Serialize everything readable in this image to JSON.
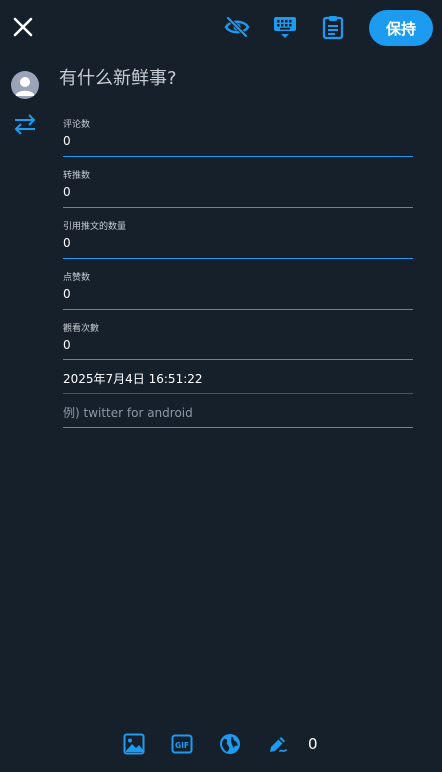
{
  "header": {
    "close_icon": "close-icon",
    "visibility_icon": "eye-off-icon",
    "keyboard_icon": "keyboard-icon",
    "clipboard_icon": "clipboard-icon",
    "save_label": "保持"
  },
  "compose": {
    "placeholder": "有什么新鲜事?"
  },
  "fields": {
    "comments": {
      "label": "评论数",
      "value": "0"
    },
    "retweets": {
      "label": "转推数",
      "value": "0"
    },
    "quotes": {
      "label": "引用推文的数量",
      "value": "0"
    },
    "likes": {
      "label": "点赞数",
      "value": "0"
    },
    "views": {
      "label": "觀看次數",
      "value": "0"
    },
    "datetime": {
      "value": "2025年7月4日 16:51:22"
    },
    "client": {
      "placeholder": "例) twitter for android"
    }
  },
  "footer": {
    "count": "0"
  },
  "colors": {
    "background": "#15202b",
    "accent": "#1d9bf0"
  }
}
